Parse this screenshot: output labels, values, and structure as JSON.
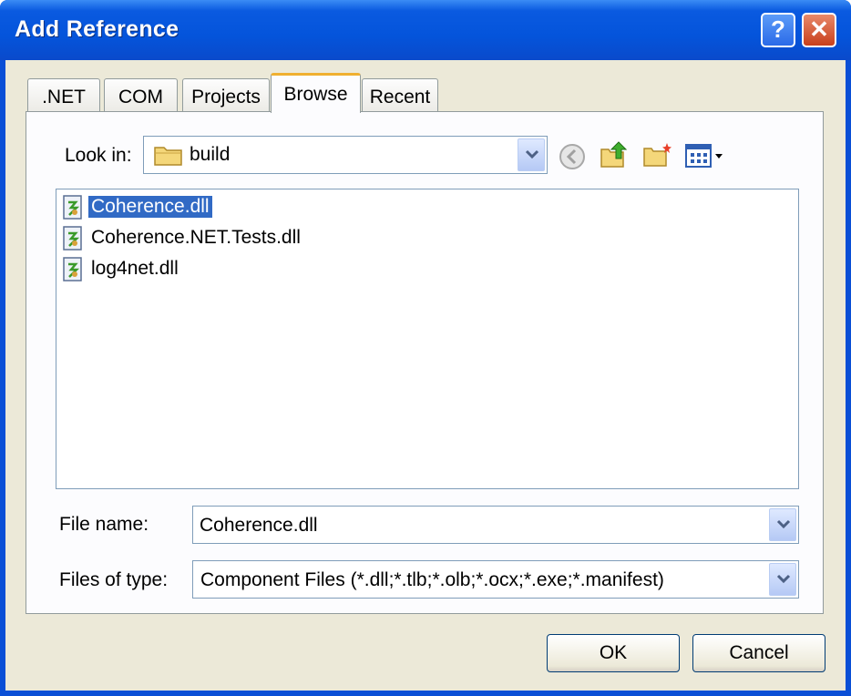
{
  "window": {
    "title": "Add Reference",
    "help_glyph": "?",
    "close_glyph": "✕"
  },
  "tabs": [
    {
      "label": ".NET",
      "active": false
    },
    {
      "label": "COM",
      "active": false
    },
    {
      "label": "Projects",
      "active": false
    },
    {
      "label": "Browse",
      "active": true
    },
    {
      "label": "Recent",
      "active": false
    }
  ],
  "lookin": {
    "label": "Look in:",
    "value": "build"
  },
  "toolbar": {
    "icons": [
      "back-icon",
      "up-folder-icon",
      "new-folder-icon",
      "view-menu-icon"
    ]
  },
  "files": [
    {
      "name": "Coherence.dll",
      "selected": true
    },
    {
      "name": "Coherence.NET.Tests.dll",
      "selected": false
    },
    {
      "name": "log4net.dll",
      "selected": false
    }
  ],
  "filename": {
    "label": "File name:",
    "value": "Coherence.dll"
  },
  "filetype": {
    "label": "Files of type:",
    "value": "Component Files (*.dll;*.tlb;*.olb;*.ocx;*.exe;*.manifest)"
  },
  "buttons": {
    "ok": "OK",
    "cancel": "Cancel"
  },
  "colors": {
    "titlebar": "#0454db",
    "selection": "#316ac5",
    "face": "#ece9d8"
  }
}
